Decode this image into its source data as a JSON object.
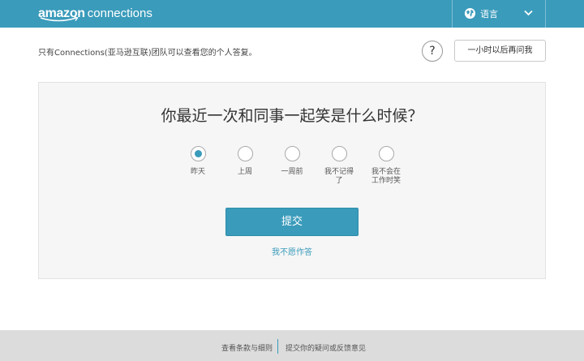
{
  "header": {
    "brand": "amazon",
    "product": "connections",
    "language_label": "语言",
    "colors": {
      "bar": "#3a9bbb"
    }
  },
  "info_text": "只有Connections(亚马逊互联)团队可以查看您的个人答复。",
  "help_label": "?",
  "ask_later_label": "一小时以后再问我",
  "survey": {
    "question": "你最近一次和同事一起笑是什么时候？",
    "options": [
      {
        "label": "昨天",
        "selected": true
      },
      {
        "label": "上周",
        "selected": false
      },
      {
        "label": "一周前",
        "selected": false
      },
      {
        "label": "我不记得了",
        "selected": false
      },
      {
        "label": "我不会在工作时笑",
        "selected": false
      }
    ],
    "submit_label": "提交",
    "decline_label": "我不愿作答"
  },
  "footer": {
    "terms_label": "查看条款与细则",
    "feedback_label": "提交你的疑问或反馈意见"
  }
}
